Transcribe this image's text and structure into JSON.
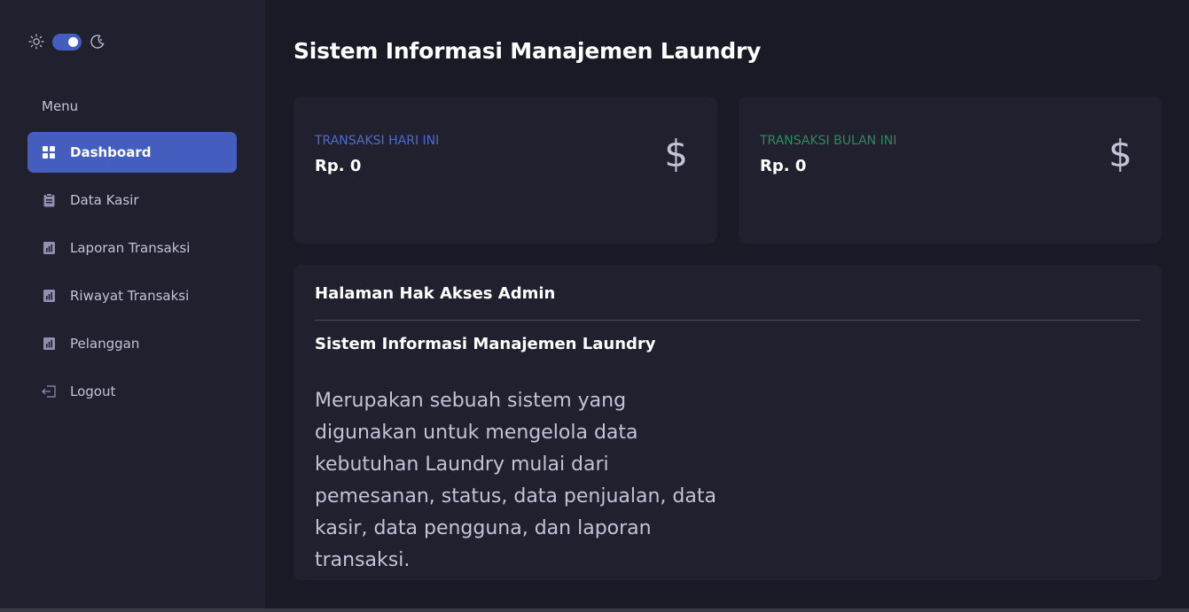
{
  "theme_toggle": {
    "mode": "dark",
    "accent": "#435ebe"
  },
  "sidebar": {
    "menu_title": "Menu",
    "items": [
      {
        "label": "Dashboard",
        "icon": "grid-icon",
        "active": true
      },
      {
        "label": "Data Kasir",
        "icon": "clipboard-icon",
        "active": false
      },
      {
        "label": "Laporan Transaksi",
        "icon": "bar-chart-icon",
        "active": false
      },
      {
        "label": "Riwayat Transaksi",
        "icon": "bar-chart-icon",
        "active": false
      },
      {
        "label": "Pelanggan",
        "icon": "bar-chart-icon",
        "active": false
      },
      {
        "label": "Logout",
        "icon": "logout-icon",
        "active": false
      }
    ]
  },
  "main": {
    "title": "Sistem Informasi Manajemen Laundry",
    "stats": [
      {
        "label": "TRANSAKSI HARI INI",
        "value": "Rp. 0",
        "icon": "dollar-icon",
        "color": "#4f6bc9"
      },
      {
        "label": "TRANSAKSI BULAN INI",
        "value": "Rp. 0",
        "icon": "dollar-icon",
        "color": "#2e8a5c"
      }
    ],
    "info": {
      "header": "Halaman Hak Akses Admin",
      "subtitle": "Sistem Informasi Manajemen Laundry",
      "description": "Merupakan sebuah sistem yang digunakan untuk mengelola data kebutuhan Laundry mulai dari pemesanan, status, data penjualan, data kasir, data pengguna, dan laporan transaksi."
    }
  }
}
